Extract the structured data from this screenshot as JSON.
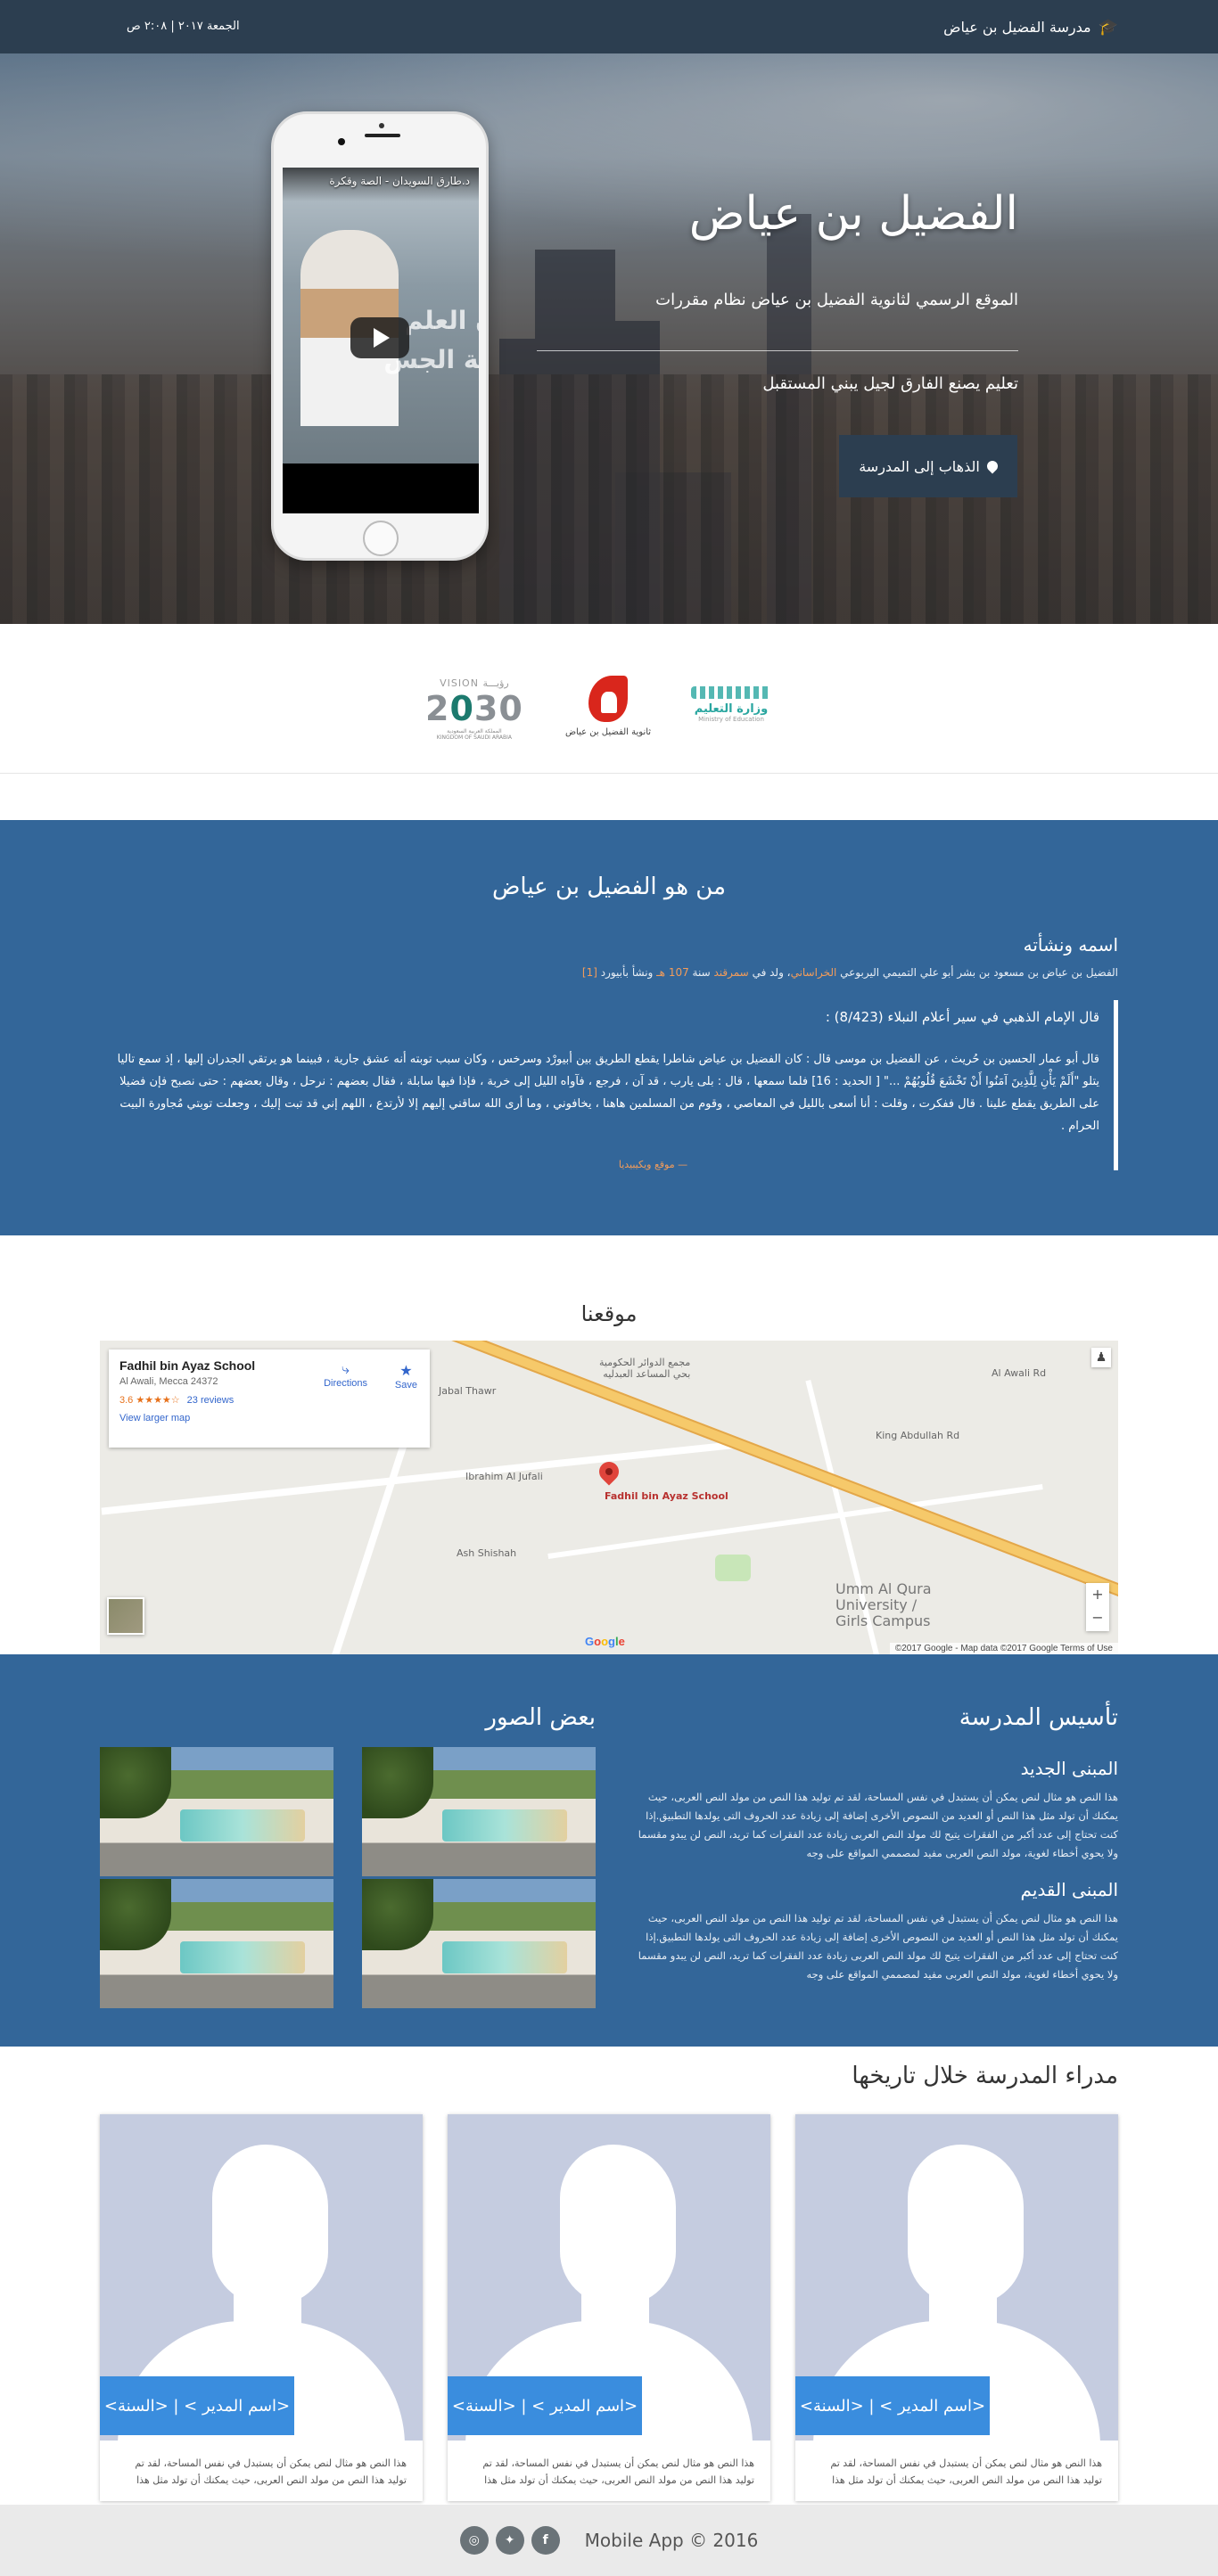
{
  "navbar": {
    "brand": "مدرسة الفضيل بن عياض",
    "brand_icon": "graduation-cap-icon",
    "date": "الجمعة ٢٠١٧ | ٢:٠٨ ص"
  },
  "hero": {
    "title": "الفضيل بن عياض",
    "subtitle": "الموقع الرسمي لثانوية الفضيل بن عياض نظام مقررات",
    "tagline": "تعليم يصنع الفارق لجيل يبني المستقبل",
    "button_label": "الذهاب إلى المدرسة",
    "button_icon": "map-marker-icon",
    "video": {
      "title": "د.طارق السويدان - الصة وقكرة",
      "overlay_text": "ن العلم\nحة الجس"
    }
  },
  "logos": {
    "vision": {
      "arabic": "رؤيـــة",
      "label": "VISION",
      "year_left": "2",
      "year_zero": "0",
      "year_right": "30",
      "caption": "المملكة العربية السعودية\nKINGDOM OF SAUDI ARABIA"
    },
    "school": {
      "caption": "ثانوية الفضيل بن عياض"
    },
    "ministry": {
      "caption": "وزارة التعليم",
      "sub": "Ministry of Education"
    }
  },
  "who": {
    "heading": "من هو الفضيل بن عياض",
    "subheading": "اسمه ونشأته",
    "intro_pre": "الفضيل بن عياض بن مسعود بن بشر أبو علي التميمي اليربوعي ",
    "intro_hl1": "الخراساني",
    "intro_mid": "، ولد في ",
    "intro_hl2": "سمرقند",
    "intro_mid2": " سنة ",
    "intro_hl3": "107 هـ",
    "intro_post": " ونشأ بأبيورد ",
    "intro_ref": "[1]",
    "quote_heading": "قال الإمام الذهبي في سير أعلام النبلاء (8/423) :",
    "quote_body": "قال أبو عمار الحسين بن حُريث ، عن الفضيل بن موسى قال : كان الفضيل بن عياض شاطرا يقطع الطريق بين أبيورْد وسرخس ، وكان سبب توبته أنه عشق جارية ، فبينما هو يرتقي الجدران إليها ، إذ سمع تاليا يتلو \"أَلَمْ يَأْنِ لِلَّذِينَ آمَنُوا أَنْ تَخْشَعَ قُلُوبُهُمْ ...\" [ الحديد : 16] فلما سمعها ، قال : بلى يارب ، قد آن ، فرجع ، فآواه الليل إلى خربة ، فإذا فيها سابلة ، فقال بعضهم : نرحل ، وقال بعضهم : حتى نصبح فإن فضيلا على الطريق يقطع علينا . قال ففكرت ، وقلت : أنا أسعى بالليل في المعاصي ، وقوم من المسلمين هاهنا ، يخافوني ، وما أرى الله ساقني إليهم إلا لأرتدع ، اللهم إني قد تبت إليك ، وجعلت توبتي مُجاورة البيت الحرام .",
    "source": "— موقع ويكيبيديا"
  },
  "location": {
    "heading": "موقعنا",
    "card": {
      "name": "Fadhil bin Ayaz School",
      "address": "Al Awali, Mecca 24372",
      "rating": "3.6 ★★★★☆",
      "reviews": "23 reviews",
      "larger_map": "View larger map",
      "directions": "Directions",
      "save": "Save"
    },
    "pin_label": "Fadhil bin Ayaz School",
    "labels": [
      "Ash Shishah",
      "Ibrahim Al Jufali",
      "King Abdullah Rd",
      "Umm Al Qura\nUniversity /\nGirls Campus",
      "مجمع الدوائر الحكومية\nبحي المساعد العبدليه",
      "Jabal Thawr",
      "Al Awali Rd"
    ],
    "google": "Google",
    "copyright": "©2017 Google - Map data ©2017 Google    Terms of Use",
    "zoom_in": "+",
    "zoom_out": "−"
  },
  "founding": {
    "heading": "تأسيس المدرسة",
    "new_building": "المبنى الجديد",
    "old_building": "المبنى القديم",
    "paragraph": "هذا النص هو مثال لنص يمكن أن يستبدل في نفس المساحة، لقد تم توليد هذا النص من مولد النص العربى، حيث يمكنك أن تولد مثل هذا النص أو العديد من النصوص الأخرى إضافة إلى زيادة عدد الحروف التى يولدها التطبيق.إذا كنت تحتاج إلى عدد أكبر من الفقرات يتيح لك مولد النص العربى زيادة عدد الفقرات كما تريد، النص لن يبدو مقسما ولا يحوي أخطاء لغوية، مولد النص العربى مفيد لمصممي المواقع على وجه",
    "photos_heading": "بعض الصور"
  },
  "principals": {
    "heading": "مدراء المدرسة خلال تاريخها",
    "items": [
      {
        "name": "<اسم المدير > | <السنة>",
        "desc": "هذا النص هو مثال لنص يمكن أن يستبدل في نفس المساحة، لقد تم توليد هذا النص من مولد النص العربى، حيث يمكنك أن تولد مثل هذا"
      },
      {
        "name": "<اسم المدير > | <السنة>",
        "desc": "هذا النص هو مثال لنص يمكن أن يستبدل في نفس المساحة، لقد تم توليد هذا النص من مولد النص العربى، حيث يمكنك أن تولد مثل هذا"
      },
      {
        "name": "<اسم المدير > | <السنة>",
        "desc": "هذا النص هو مثال لنص يمكن أن يستبدل في نفس المساحة، لقد تم توليد هذا النص من مولد النص العربى، حيث يمكنك أن تولد مثل هذا"
      }
    ]
  },
  "footer": {
    "copyright": "Mobile App © 2016",
    "icons": [
      "instagram-icon",
      "twitter-icon",
      "facebook-icon"
    ]
  },
  "colors": {
    "navbar": "#2c3e50",
    "section_blue": "#336699",
    "accent_orange": "#f39c5a",
    "name_bar": "#3a8dde"
  }
}
